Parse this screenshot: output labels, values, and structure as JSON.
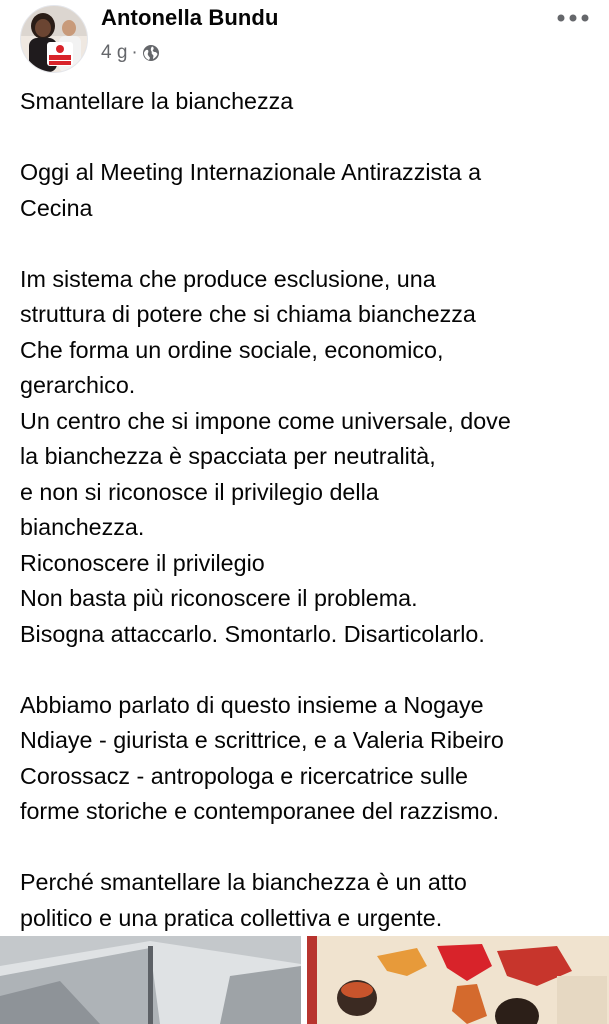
{
  "author": {
    "name": "Antonella Bundu",
    "time_ago": "4 g",
    "separator": "·",
    "audience_icon": "globe-icon",
    "avatar_badge_lines": [
      "TOSCANA",
      "ROSSA"
    ]
  },
  "menu_icon": "more-horizontal-icon",
  "post": {
    "lines": [
      "Smantellare la bianchezza",
      "",
      "Oggi al Meeting Internazionale Antirazzista a",
      "Cecina",
      "",
      "Im sistema che produce esclusione, una",
      "struttura di potere che si chiama bianchezza",
      "Che forma un ordine sociale, economico,",
      "gerarchico.",
      "Un centro che si impone come universale, dove",
      "la bianchezza è spacciata per neutralità,",
      "e non si riconosce il privilegio della",
      "bianchezza.",
      "Riconoscere il privilegio",
      "Non basta più riconoscere il problema.",
      "Bisogna attaccarlo. Smontarlo. Disarticolarlo.",
      "",
      "Abbiamo parlato di questo insieme a Nogaye",
      "Ndiaye - giurista e scrittrice, e a Valeria Ribeiro",
      "Corossacz - antropologa e ricercatrice sulle",
      "forme storiche e contemporanee del razzismo.",
      "",
      "Perché smantellare la bianchezza è un atto",
      "politico e una pratica collettiva e urgente."
    ]
  },
  "colors": {
    "text_primary": "#050505",
    "text_secondary": "#65676b",
    "badge_red": "#d8232a"
  }
}
